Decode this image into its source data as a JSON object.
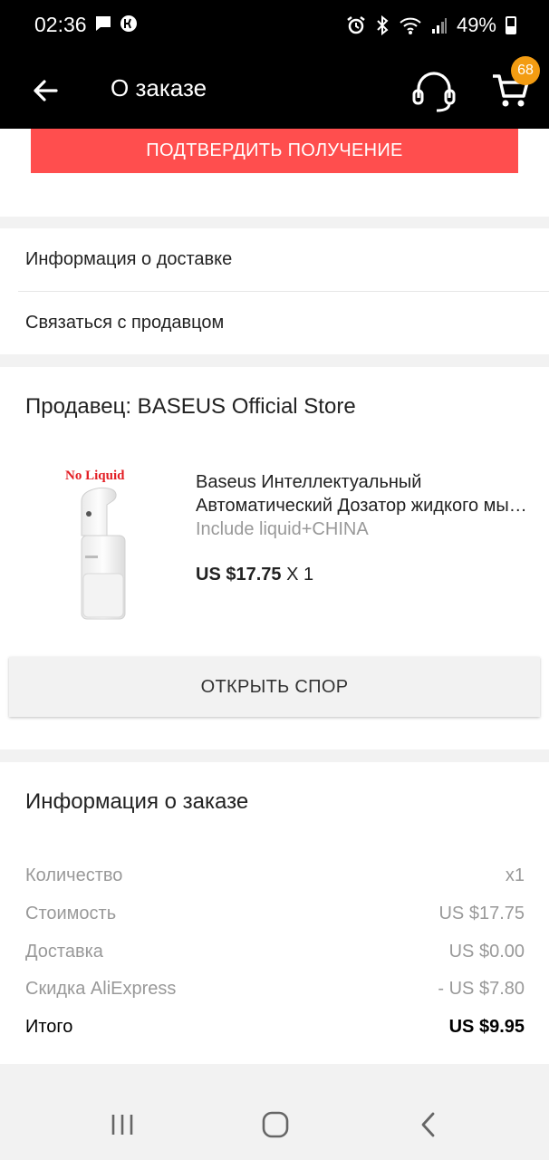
{
  "status_bar": {
    "time": "02:36",
    "battery": "49%"
  },
  "app_bar": {
    "title": "О заказе",
    "cart_count": "68"
  },
  "confirm": {
    "button_label": "ПОДТВЕРДИТЬ ПОЛУЧЕНИЕ",
    "color": "#ff4e4e"
  },
  "links": [
    {
      "label": "Информация о доставке"
    },
    {
      "label": "Связаться с продавцом"
    }
  ],
  "product": {
    "seller": "Продавец: BASEUS Official Store",
    "image_label": "No Liquid",
    "title_line1": "Baseus Интеллектуальный",
    "title_line2": "Автоматический Дозатор жидкого мыла",
    "variant": "Include liquid+CHINA",
    "price": "US $17.75",
    "quantity": "X 1"
  },
  "dispute": {
    "button_label": "ОТКРЫТЬ СПОР"
  },
  "order_info": {
    "title": "Информация о заказе",
    "rows": [
      {
        "label": "Количество",
        "value": "x1"
      },
      {
        "label": "Стоимость",
        "value": "US $17.75"
      },
      {
        "label": "Доставка",
        "value": "US $0.00"
      },
      {
        "label": "Скидка AliExpress",
        "value": "- US $7.80"
      },
      {
        "label": "Итого",
        "value": "US $9.95"
      }
    ]
  },
  "colors": {
    "accent": "#ff4e4e",
    "badge": "#f39c12"
  }
}
